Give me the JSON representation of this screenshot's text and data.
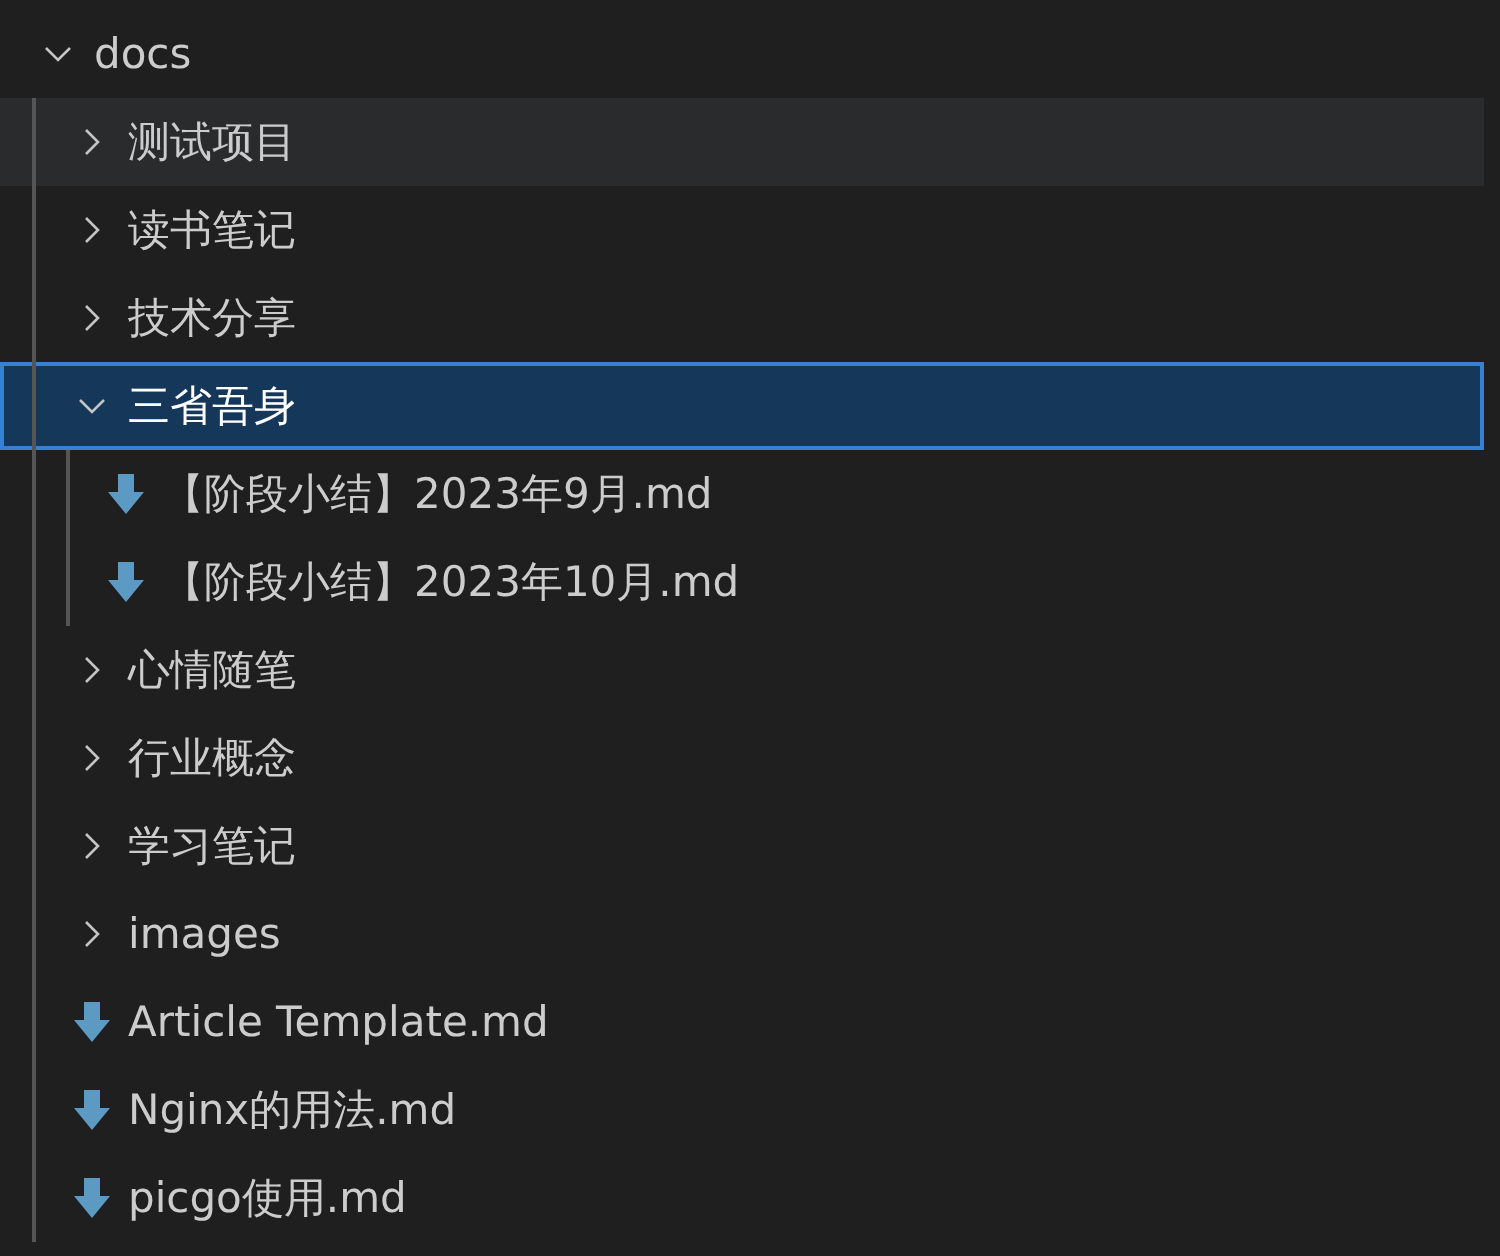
{
  "tree": {
    "name": "docs",
    "kind": "folder",
    "expanded": true,
    "selected": false,
    "hovered": false,
    "children": [
      {
        "name": "测试项目",
        "kind": "folder",
        "expanded": false,
        "selected": false,
        "hovered": true
      },
      {
        "name": "读书笔记",
        "kind": "folder",
        "expanded": false,
        "selected": false,
        "hovered": false
      },
      {
        "name": "技术分享",
        "kind": "folder",
        "expanded": false,
        "selected": false,
        "hovered": false
      },
      {
        "name": "三省吾身",
        "kind": "folder",
        "expanded": true,
        "selected": true,
        "hovered": false,
        "children": [
          {
            "name": "【阶段小结】2023年9月.md",
            "kind": "file",
            "selected": false,
            "hovered": false
          },
          {
            "name": "【阶段小结】2023年10月.md",
            "kind": "file",
            "selected": false,
            "hovered": false
          }
        ]
      },
      {
        "name": "心情随笔",
        "kind": "folder",
        "expanded": false,
        "selected": false,
        "hovered": false
      },
      {
        "name": "行业概念",
        "kind": "folder",
        "expanded": false,
        "selected": false,
        "hovered": false
      },
      {
        "name": "学习笔记",
        "kind": "folder",
        "expanded": false,
        "selected": false,
        "hovered": false
      },
      {
        "name": "images",
        "kind": "folder",
        "expanded": false,
        "selected": false,
        "hovered": false
      },
      {
        "name": "Article Template.md",
        "kind": "file",
        "selected": false,
        "hovered": false
      },
      {
        "name": "Nginx的用法.md",
        "kind": "file",
        "selected": false,
        "hovered": false
      },
      {
        "name": "picgo使用.md",
        "kind": "file",
        "selected": false,
        "hovered": false
      }
    ]
  }
}
